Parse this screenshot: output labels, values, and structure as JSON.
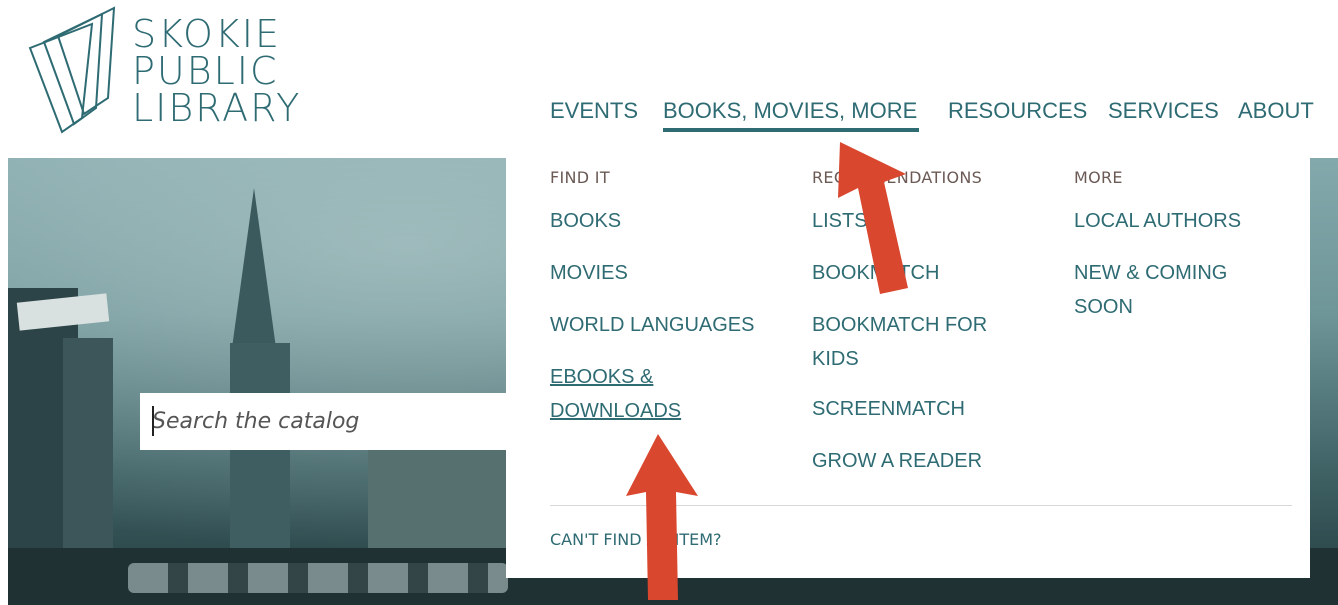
{
  "logo": {
    "line1": "SKOKIE",
    "line2": "PUBLIC",
    "line3": "LIBRARY"
  },
  "nav": {
    "items": [
      "EVENTS",
      "BOOKS, MOVIES, MORE",
      "RESOURCES",
      "SERVICES",
      "ABOUT"
    ],
    "active": "BOOKS, MOVIES, MORE"
  },
  "search": {
    "placeholder": "Search the catalog"
  },
  "dropdown": {
    "find_it": {
      "title": "FIND IT",
      "links": [
        "BOOKS",
        "MOVIES",
        "WORLD LANGUAGES",
        "EBOOKS &\nDOWNLOADS"
      ]
    },
    "recommendations": {
      "title": "RECOMMENDATIONS",
      "links": [
        "LISTS",
        "BOOKMATCH",
        "BOOKMATCH FOR\nKIDS",
        "SCREENMATCH",
        "GROW A READER"
      ]
    },
    "more": {
      "title": "MORE",
      "links": [
        "LOCAL AUTHORS",
        "NEW & COMING\nSOON"
      ]
    },
    "footer_link": "CAN'T FIND AN ITEM?"
  },
  "colors": {
    "accent": "#2e6b73",
    "arrow": "#d9472f"
  },
  "icons": [
    "library-logo-icon",
    "arrow-annotation-icon"
  ]
}
